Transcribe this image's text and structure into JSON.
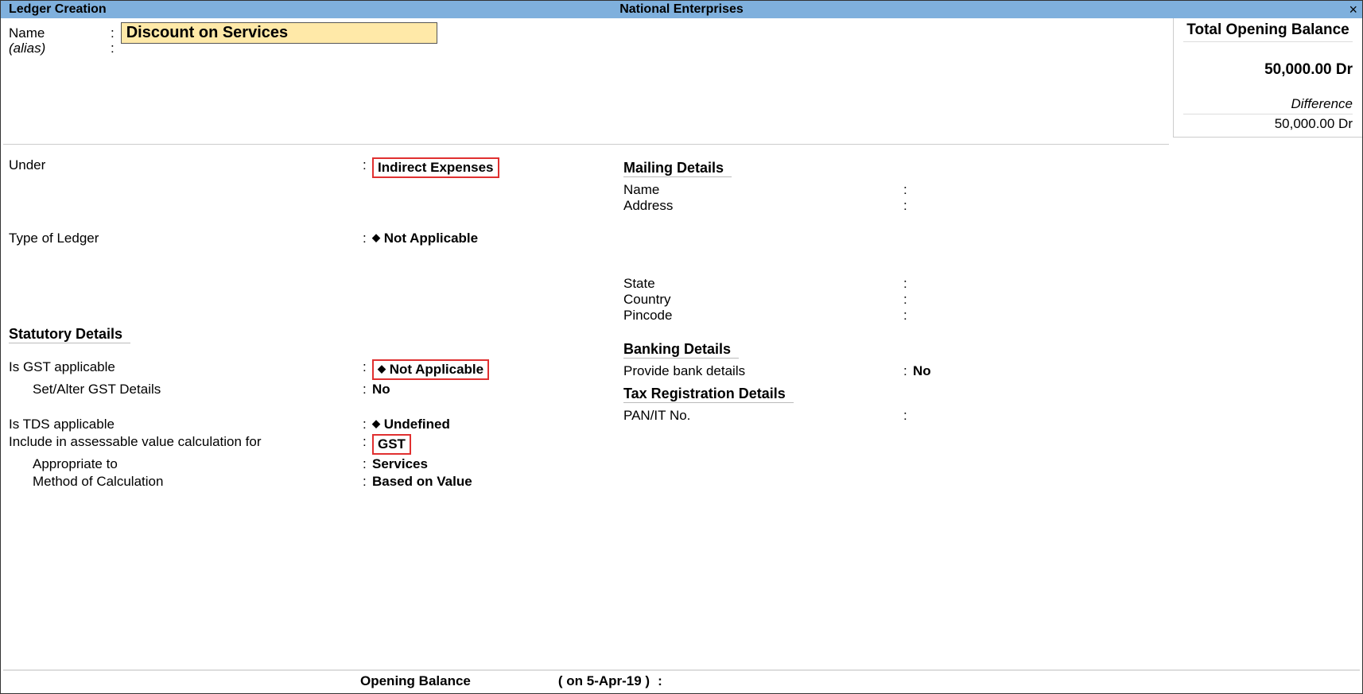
{
  "header": {
    "title_left": "Ledger Creation",
    "title_center": "National Enterprises",
    "close_glyph": "×"
  },
  "name": {
    "label": "Name",
    "value": "Discount on Services",
    "alias_label": "(alias)"
  },
  "balance": {
    "title": "Total Opening Balance",
    "value": "50,000.00 Dr",
    "diff_label": "Difference",
    "diff_value": "50,000.00 Dr"
  },
  "left": {
    "under": {
      "label": "Under",
      "value": "Indirect Expenses"
    },
    "type_of_ledger": {
      "label": "Type of Ledger",
      "value": "Not Applicable"
    },
    "statutory_title": "Statutory Details",
    "gst_applicable": {
      "label": "Is GST applicable",
      "value": "Not Applicable"
    },
    "set_alter_gst": {
      "label": "Set/Alter GST Details",
      "value": "No"
    },
    "tds_applicable": {
      "label": "Is TDS applicable",
      "value": "Undefined"
    },
    "include_assess": {
      "label": "Include in assessable value calculation for",
      "value": "GST"
    },
    "appropriate_to": {
      "label": "Appropriate to",
      "value": "Services"
    },
    "method_calc": {
      "label": "Method of Calculation",
      "value": "Based on Value"
    }
  },
  "right": {
    "mailing_title": "Mailing Details",
    "mail_name": {
      "label": "Name"
    },
    "mail_address": {
      "label": "Address"
    },
    "state": {
      "label": "State"
    },
    "country": {
      "label": "Country"
    },
    "pincode": {
      "label": "Pincode"
    },
    "banking_title": "Banking Details",
    "provide_bank": {
      "label": "Provide bank details",
      "value": "No"
    },
    "tax_title": "Tax Registration Details",
    "pan": {
      "label": "PAN/IT No."
    }
  },
  "footer": {
    "label": "Opening Balance",
    "date": "( on 5-Apr-19 )"
  }
}
